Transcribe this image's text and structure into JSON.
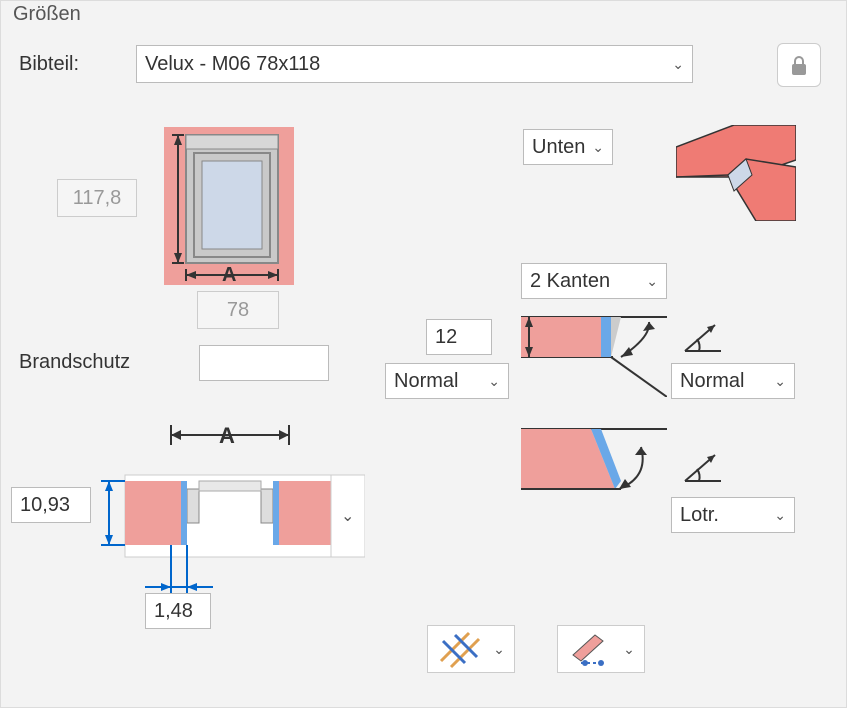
{
  "group_title": "Größen",
  "bibteil_label": "Bibteil:",
  "bibteil_value": "Velux - M06 78x118",
  "height_value": "117,8",
  "width_value": "78",
  "brandschutz_label": "Brandschutz",
  "brandschutz_value": "",
  "pos_select": "Unten",
  "edges_select": "2 Kanten",
  "top_value": "12",
  "left_select": "Normal",
  "right_select1": "Normal",
  "right_select2": "Lotr.",
  "dim_a_value": "10,93",
  "dim_b_value": "1,48",
  "letter_A": "A",
  "colors": {
    "salmon": "#ef9f9b",
    "lightblue": "#cdd8e8",
    "blue": "#0066cc",
    "gray": "#888"
  }
}
